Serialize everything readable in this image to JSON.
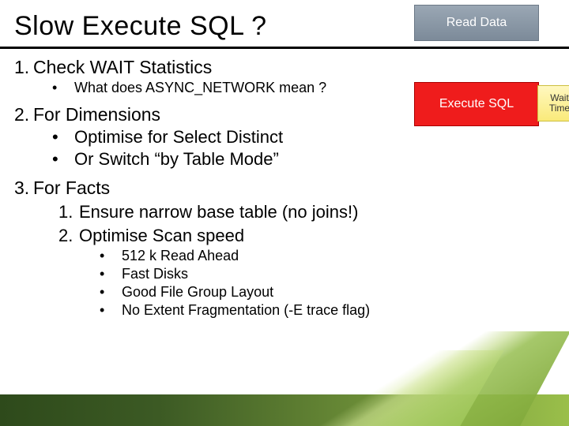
{
  "title": "Slow Execute SQL ?",
  "boxes": {
    "read": "Read Data",
    "exec": "Execute SQL",
    "wait1": "Wait",
    "wait2": "Time"
  },
  "items": {
    "p1": {
      "num": "1.",
      "text": "Check WAIT Statistics",
      "sub": [
        {
          "dot": "•",
          "text": "What does ASYNC_NETWORK mean ?"
        }
      ]
    },
    "p2": {
      "num": "2.",
      "text": "For Dimensions",
      "sub": [
        {
          "dot": "•",
          "text": "Optimise for Select Distinct"
        },
        {
          "dot": "•",
          "text": "Or Switch “by Table Mode”"
        }
      ]
    },
    "p3": {
      "num": "3.",
      "text": "For Facts",
      "sub": [
        {
          "num": "1.",
          "text": "Ensure narrow base table (no joins!)"
        },
        {
          "num": "2.",
          "text": "Optimise Scan speed",
          "sub": [
            {
              "dot": "•",
              "text": "512 k Read Ahead"
            },
            {
              "dot": "•",
              "text": "Fast Disks"
            },
            {
              "dot": "•",
              "text": "Good File Group Layout"
            },
            {
              "dot": "•",
              "text": "No Extent Fragmentation (-E trace flag)"
            }
          ]
        }
      ]
    }
  }
}
